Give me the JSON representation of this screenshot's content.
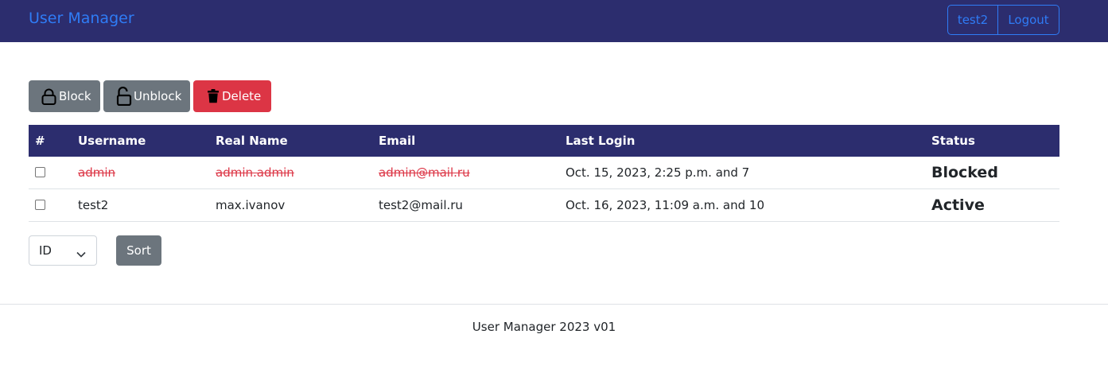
{
  "navbar": {
    "brand": "User Manager",
    "current_user": "test2",
    "logout_label": "Logout",
    "background_color": "#2c2d6e",
    "link_color": "#2f7cf6"
  },
  "toolbar": {
    "block_label": "Block",
    "unblock_label": "Unblock",
    "delete_label": "Delete",
    "block_icon": "lock-icon",
    "unblock_icon": "unlock-icon",
    "delete_icon": "trash-icon",
    "secondary_color": "#6c757d",
    "danger_color": "#dc3545"
  },
  "table": {
    "headers": {
      "num": "#",
      "username": "Username",
      "real_name": "Real Name",
      "email": "Email",
      "last_login": "Last Login",
      "status": "Status"
    },
    "rows": [
      {
        "checked": false,
        "username": "admin",
        "real_name": "admin.admin",
        "email": "admin@mail.ru",
        "last_login": "Oct. 15, 2023, 2:25 p.m. and 7",
        "status": "Blocked",
        "blocked": true
      },
      {
        "checked": false,
        "username": "test2",
        "real_name": "max.ivanov",
        "email": "test2@mail.ru",
        "last_login": "Oct. 16, 2023, 11:09 a.m. and 10",
        "status": "Active",
        "blocked": false
      }
    ]
  },
  "sort": {
    "selected": "ID",
    "button_label": "Sort"
  },
  "footer": {
    "text": "User Manager 2023 v01"
  }
}
